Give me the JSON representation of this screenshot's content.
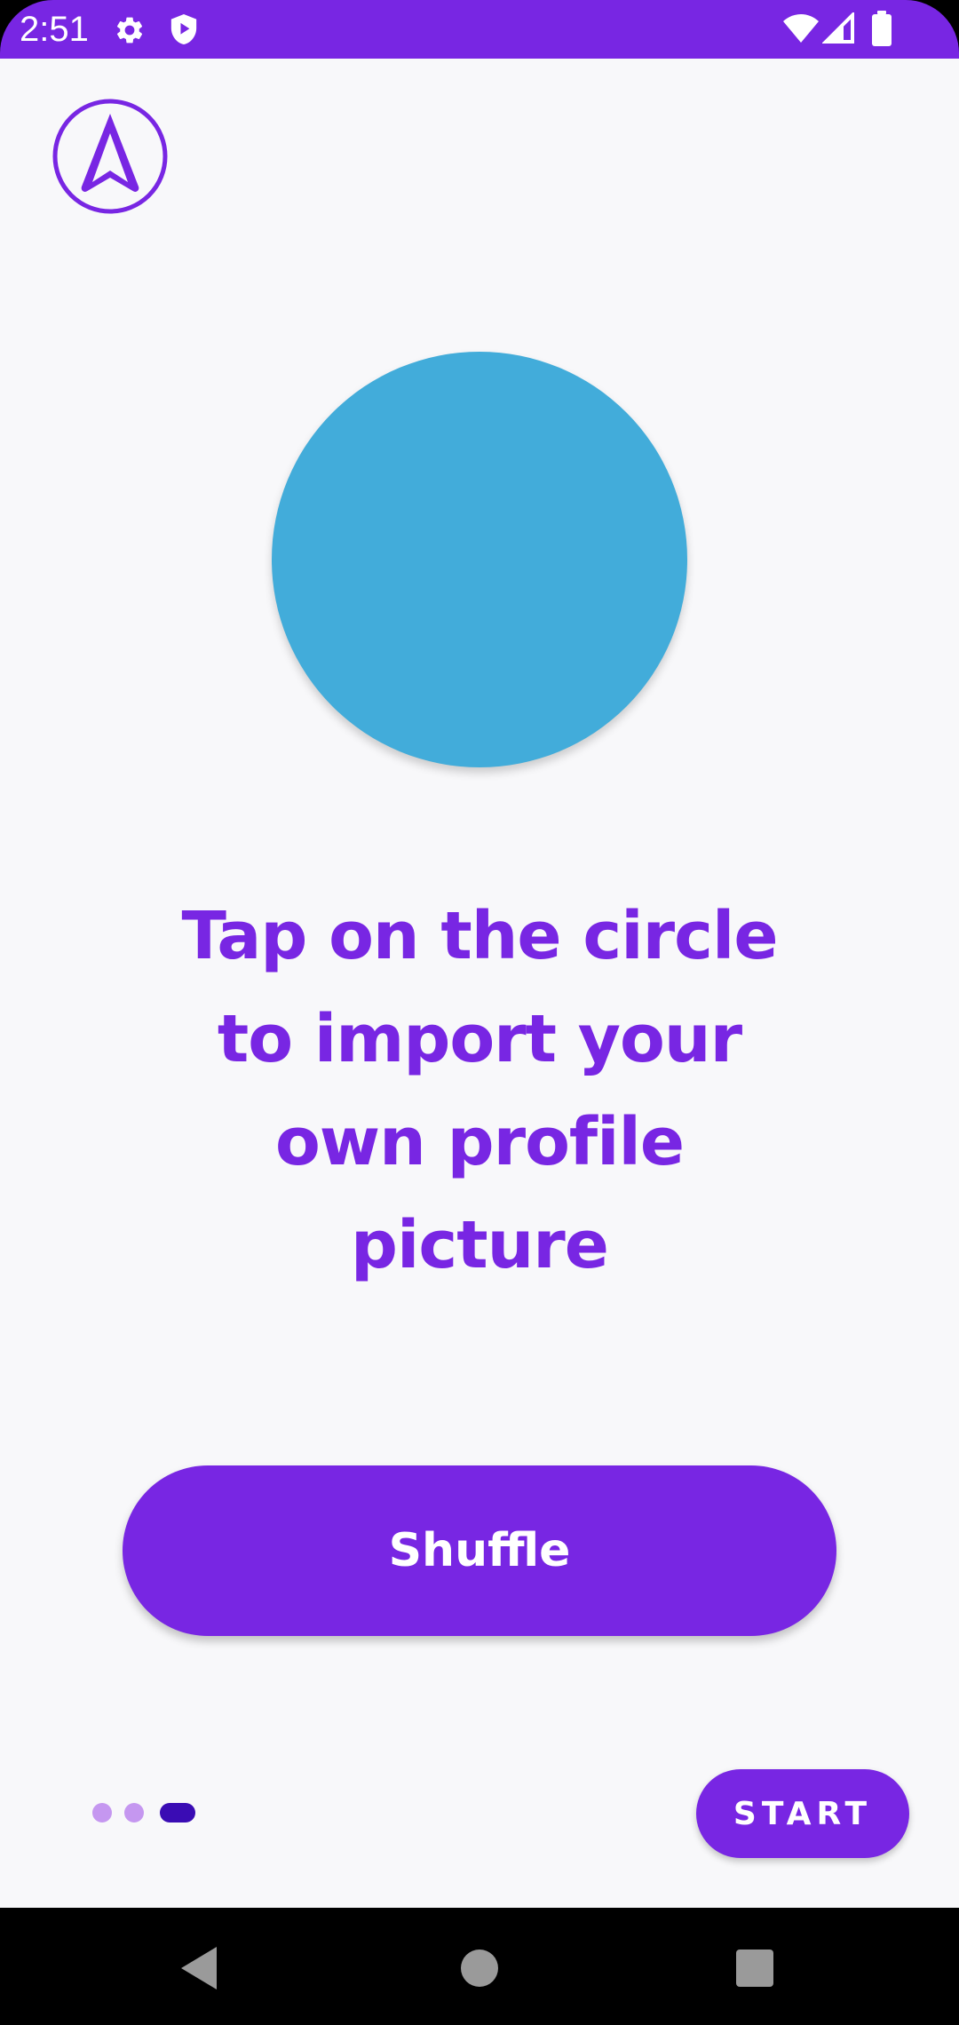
{
  "status_bar": {
    "time": "2:51",
    "background_color": "#7826E3",
    "left_icons": [
      "settings-icon",
      "shield-play-icon"
    ],
    "right_icons": [
      "wifi-icon",
      "cell-signal-icon",
      "battery-icon"
    ]
  },
  "app": {
    "logo_icon": "navigation-arrow-logo-icon",
    "accent_color": "#7826E3",
    "profile_circle_color": "#42ACDA",
    "instruction_lines": [
      "Tap on the circle",
      "to import your",
      "own profile",
      "picture"
    ],
    "shuffle_label": "Shuffle",
    "start_label": "START",
    "pager": {
      "total_pages": 3,
      "active_page": 3,
      "inactive_color": "#C597F0",
      "active_color": "#3A0CB4"
    }
  },
  "nav_bar": {
    "buttons": [
      "back-icon",
      "home-icon",
      "recents-icon"
    ]
  }
}
